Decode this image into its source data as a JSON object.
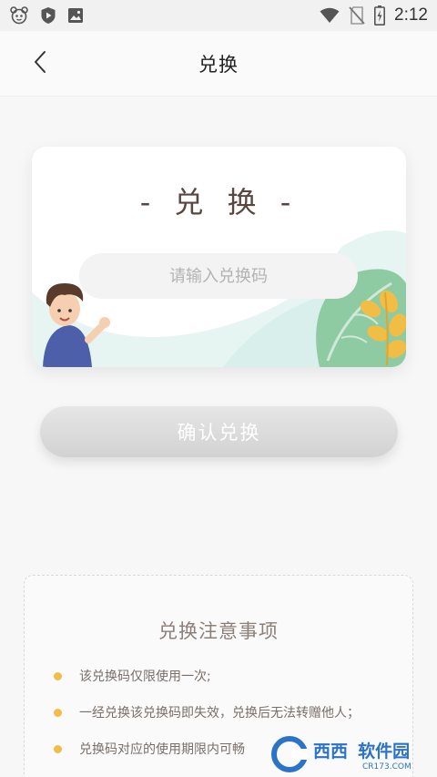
{
  "status_bar": {
    "time": "2:12",
    "icons": [
      "app-mascot-icon",
      "shield-play-icon",
      "image-icon",
      "wifi-icon",
      "no-sim-icon",
      "battery-charging-icon"
    ]
  },
  "header": {
    "back_icon": "chevron-left-icon",
    "title": "兑换"
  },
  "redeem_card": {
    "title": "- 兑 换 -",
    "input": {
      "placeholder": "请输入兑换码",
      "value": ""
    }
  },
  "confirm_button": {
    "label": "确认兑换",
    "state": "disabled"
  },
  "notes": {
    "title": "兑换注意事项",
    "items": [
      "该兑换码仅限使用一次;",
      "一经兑换该兑换码即失效，兑换后无法转赠他人；",
      "兑换码对应的使用期限内可畅"
    ]
  },
  "watermark": {
    "brand": "西西",
    "suffix": "软件园",
    "site": "CR173.COM"
  },
  "colors": {
    "accent_dot": "#f2bd44",
    "title_brown": "#5a4640",
    "button_gray": "#d9d9d9",
    "leaf_green": "#8ecaa2"
  }
}
